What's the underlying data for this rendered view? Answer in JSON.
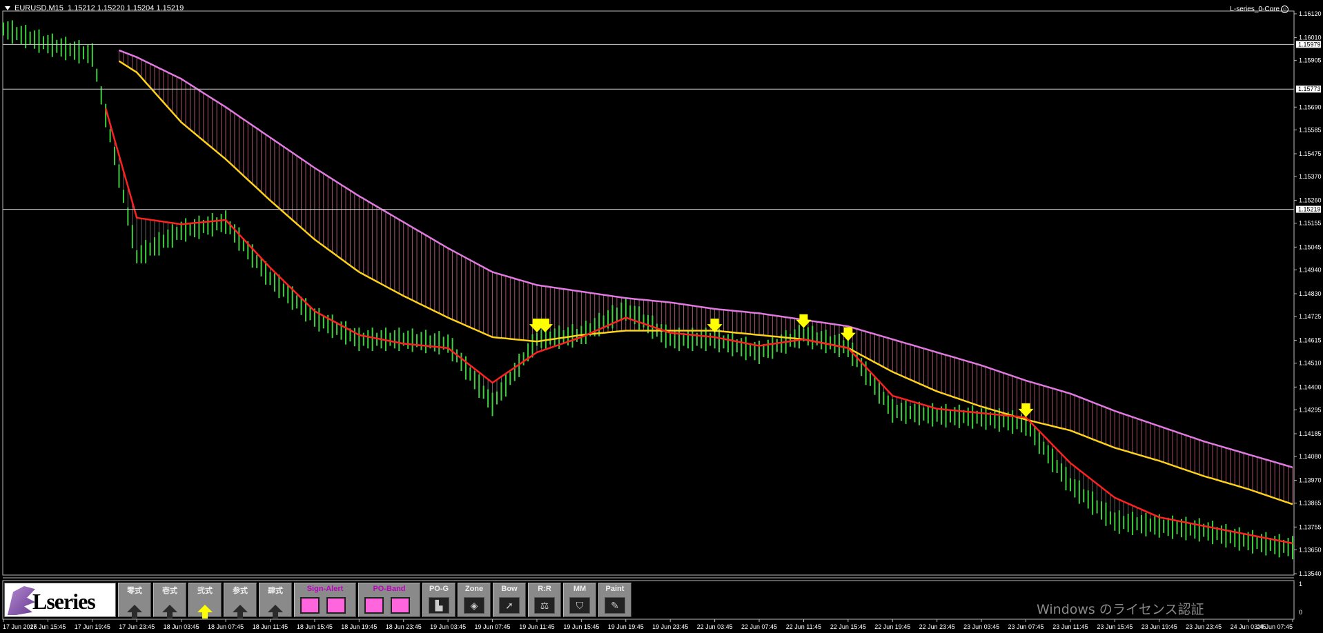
{
  "window": {
    "symbol_line": "EURUSD,M15  1.15212 1.15220 1.15204 1.15219",
    "indicator_name": "L-series_0-Core",
    "watermark": "Windows のライセンス認証"
  },
  "colors": {
    "background": "#000000",
    "candles": "#3ecf3e",
    "fast_ma": "#ff2020",
    "slow_ma": "#ffd21a",
    "upper_band": "#e07ae0",
    "band_fill": "#d9708a",
    "signal_arrow": "#ffff00",
    "grid_line": "#d0d0d0"
  },
  "price_axis": {
    "ticks": [
      "1.16120",
      "1.16010",
      "1.15905",
      "1.15690",
      "1.15585",
      "1.15475",
      "1.15370",
      "1.15260",
      "1.15155",
      "1.15045",
      "1.14940",
      "1.14830",
      "1.14725",
      "1.14615",
      "1.14510",
      "1.14400",
      "1.14295",
      "1.14185",
      "1.14080",
      "1.13970",
      "1.13865",
      "1.13755",
      "1.13650",
      "1.13540"
    ],
    "labels_marked": [
      "1.15979",
      "1.15773",
      "1.15219"
    ],
    "subwindow_ticks": [
      "1",
      "0"
    ]
  },
  "time_axis": [
    "17 Jun 2026",
    "17 Jun 15:45",
    "17 Jun 19:45",
    "17 Jun 23:45",
    "18 Jun 03:45",
    "18 Jun 07:45",
    "18 Jun 11:45",
    "18 Jun 15:45",
    "18 Jun 19:45",
    "18 Jun 23:45",
    "19 Jun 03:45",
    "19 Jun 07:45",
    "19 Jun 11:45",
    "19 Jun 15:45",
    "19 Jun 19:45",
    "19 Jun 23:45",
    "22 Jun 03:45",
    "22 Jun 07:45",
    "22 Jun 11:45",
    "22 Jun 15:45",
    "22 Jun 19:45",
    "22 Jun 23:45",
    "23 Jun 03:45",
    "23 Jun 07:45",
    "23 Jun 11:45",
    "23 Jun 15:45",
    "23 Jun 19:45",
    "23 Jun 23:45",
    "24 Jun 03:45",
    "24 Jun 07:45"
  ],
  "chart_data": {
    "type": "line",
    "title": "",
    "ylim": [
      1.1354,
      1.1612
    ],
    "horizontal_levels": [
      1.15979,
      1.15773,
      1.15219
    ],
    "x": [
      "17 Jun 2026",
      "17 Jun 15:45",
      "17 Jun 19:45",
      "17 Jun 23:45",
      "18 Jun 03:45",
      "18 Jun 07:45",
      "18 Jun 11:45",
      "18 Jun 15:45",
      "18 Jun 19:45",
      "18 Jun 23:45",
      "19 Jun 03:45",
      "19 Jun 07:45",
      "19 Jun 11:45",
      "19 Jun 15:45",
      "19 Jun 19:45",
      "19 Jun 23:45",
      "22 Jun 03:45",
      "22 Jun 07:45",
      "22 Jun 11:45",
      "22 Jun 15:45",
      "22 Jun 19:45",
      "22 Jun 23:45",
      "23 Jun 03:45",
      "23 Jun 07:45",
      "23 Jun 11:45",
      "23 Jun 15:45",
      "23 Jun 19:45",
      "23 Jun 23:45",
      "24 Jun 03:45",
      "24 Jun 07:45"
    ],
    "series": [
      {
        "values": [
          1.1605,
          1.1598,
          1.1593,
          1.15,
          1.1512,
          1.1516,
          1.149,
          1.1472,
          1.1462,
          1.1462,
          1.146,
          1.1432,
          1.1462,
          1.1464,
          1.1476,
          1.1462,
          1.1462,
          1.1456,
          1.1464,
          1.1458,
          1.1429,
          1.1427,
          1.1426,
          1.1423,
          1.1395,
          1.1378,
          1.1376,
          1.1374,
          1.1369,
          1.1366
        ]
      },
      {
        "values": [
          1.1603,
          1.1596,
          1.159,
          1.1518,
          1.1515,
          1.1517,
          1.1495,
          1.1475,
          1.1464,
          1.146,
          1.1458,
          1.1442,
          1.1456,
          1.1463,
          1.1472,
          1.1465,
          1.1463,
          1.1459,
          1.1462,
          1.1458,
          1.1436,
          1.143,
          1.1428,
          1.1426,
          1.1405,
          1.1389,
          1.138,
          1.1376,
          1.1372,
          1.1368
        ]
      },
      {
        "values": [
          1.1607,
          1.1602,
          1.1598,
          1.1585,
          1.1562,
          1.1545,
          1.1526,
          1.1508,
          1.1493,
          1.1482,
          1.1472,
          1.1463,
          1.1461,
          1.1464,
          1.1466,
          1.1466,
          1.1466,
          1.1464,
          1.1462,
          1.1458,
          1.1447,
          1.1438,
          1.1431,
          1.1425,
          1.142,
          1.1412,
          1.1406,
          1.1399,
          1.1393,
          1.1386
        ]
      },
      {
        "values": [
          1.1608,
          1.1604,
          1.16,
          1.1592,
          1.1582,
          1.1569,
          1.1555,
          1.1541,
          1.1528,
          1.1516,
          1.1504,
          1.1493,
          1.1487,
          1.1484,
          1.1481,
          1.1479,
          1.1476,
          1.1474,
          1.1471,
          1.1468,
          1.1462,
          1.1456,
          1.145,
          1.1443,
          1.1437,
          1.1429,
          1.1422,
          1.1415,
          1.1409,
          1.1403
        ]
      }
    ],
    "signal_arrows_down": [
      "19 Jun 11:45",
      "19 Jun 11:45",
      "22 Jun 03:45",
      "22 Jun 11:45",
      "22 Jun 15:45",
      "23 Jun 07:45"
    ]
  },
  "toolbar": {
    "logo_text": "Lseries",
    "buttons": [
      {
        "label": "零式",
        "style": "gray"
      },
      {
        "label": "壱式",
        "style": "gray"
      },
      {
        "label": "弐式",
        "style": "yellow"
      },
      {
        "label": "参式",
        "style": "gray"
      },
      {
        "label": "肆式",
        "style": "gray"
      }
    ],
    "sign_alert": "Sign-Alert",
    "po_band": "PO-Band",
    "tools": [
      {
        "label": "PO-G",
        "icon": "▙"
      },
      {
        "label": "Zone",
        "icon": "◈"
      },
      {
        "label": "Bow",
        "icon": "➚"
      },
      {
        "label": "R:R",
        "icon": "⚖"
      },
      {
        "label": "MM",
        "icon": "⛉"
      },
      {
        "label": "Paint",
        "icon": "✎"
      }
    ]
  }
}
